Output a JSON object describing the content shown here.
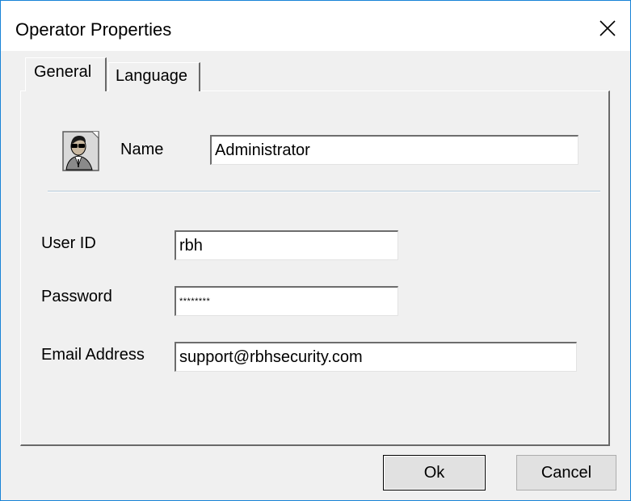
{
  "window": {
    "title": "Operator Properties",
    "close_icon": "close-icon"
  },
  "tabs": [
    {
      "label": "General",
      "selected": true
    },
    {
      "label": "Language",
      "selected": false
    }
  ],
  "general": {
    "avatar_icon": "operator-avatar-icon",
    "name_label": "Name",
    "name_value": "Administrator",
    "user_id_label": "User ID",
    "user_id_value": "rbh",
    "password_label": "Password",
    "password_value": "********",
    "email_label": "Email Address",
    "email_value": "support@rbhsecurity.com"
  },
  "buttons": {
    "ok_label": "Ok",
    "cancel_label": "Cancel"
  }
}
